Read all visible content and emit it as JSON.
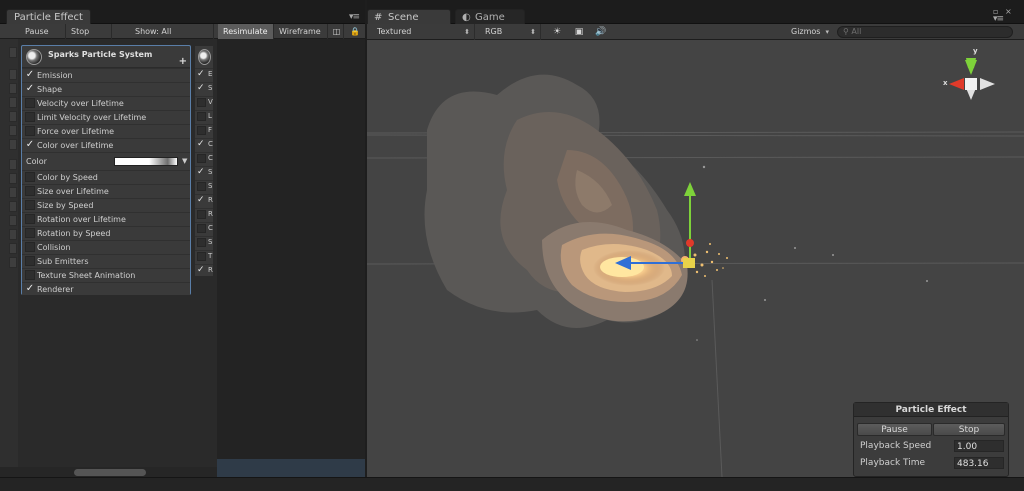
{
  "particle_effect_window": {
    "tab_title": "Particle Effect",
    "toolbar": {
      "pause": "Pause",
      "stop": "Stop",
      "show": "Show: All",
      "resimulate": "Resimulate",
      "wireframe": "Wireframe"
    },
    "system": {
      "name": "Sparks Particle System",
      "modules": [
        {
          "label": "Emission",
          "checked": true
        },
        {
          "label": "Shape",
          "checked": true
        },
        {
          "label": "Velocity over Lifetime",
          "checked": false
        },
        {
          "label": "Limit Velocity over Lifetime",
          "checked": false
        },
        {
          "label": "Force over Lifetime",
          "checked": false
        },
        {
          "label": "Color over Lifetime",
          "checked": true
        }
      ],
      "color_field": {
        "label": "Color"
      },
      "modules_after": [
        {
          "label": "Color by Speed",
          "checked": false
        },
        {
          "label": "Size over Lifetime",
          "checked": false
        },
        {
          "label": "Size by Speed",
          "checked": false
        },
        {
          "label": "Rotation over Lifetime",
          "checked": false
        },
        {
          "label": "Rotation by Speed",
          "checked": false
        },
        {
          "label": "Collision",
          "checked": false
        },
        {
          "label": "Sub Emitters",
          "checked": false
        },
        {
          "label": "Texture Sheet Animation",
          "checked": false
        },
        {
          "label": "Renderer",
          "checked": true
        }
      ]
    },
    "second_system_rows": [
      {
        "letter": "E",
        "checked": true
      },
      {
        "letter": "S",
        "checked": true
      },
      {
        "letter": "V",
        "checked": false
      },
      {
        "letter": "L",
        "checked": false
      },
      {
        "letter": "F",
        "checked": false
      },
      {
        "letter": "C",
        "checked": true
      },
      {
        "letter": "C",
        "checked": false
      },
      {
        "letter": "S",
        "checked": true
      },
      {
        "letter": "S",
        "checked": false
      },
      {
        "letter": "R",
        "checked": true
      },
      {
        "letter": "R",
        "checked": false
      },
      {
        "letter": "C",
        "checked": false
      },
      {
        "letter": "S",
        "checked": false
      },
      {
        "letter": "T",
        "checked": false
      },
      {
        "letter": "R",
        "checked": true
      }
    ]
  },
  "scene_window": {
    "tabs": {
      "scene": "Scene",
      "game": "Game"
    },
    "toolbar": {
      "render_mode": "Textured",
      "color_mode": "RGB",
      "gizmos": "Gizmos",
      "search_placeholder": "All"
    },
    "orientation_gizmo": {
      "y_label": "y",
      "x_label": "x"
    }
  },
  "overlay": {
    "title": "Particle Effect",
    "pause": "Pause",
    "stop": "Stop",
    "playback_speed_label": "Playback Speed",
    "playback_speed": "1.00",
    "playback_time_label": "Playback Time",
    "playback_time": "483.16"
  },
  "colors": {
    "selection_border": "#5a7ea8",
    "gizmo_y": "#7ed23a",
    "gizmo_x": "#e03a2a",
    "gizmo_z": "#2f6fd6",
    "flame_core": "#ffe6a0"
  }
}
